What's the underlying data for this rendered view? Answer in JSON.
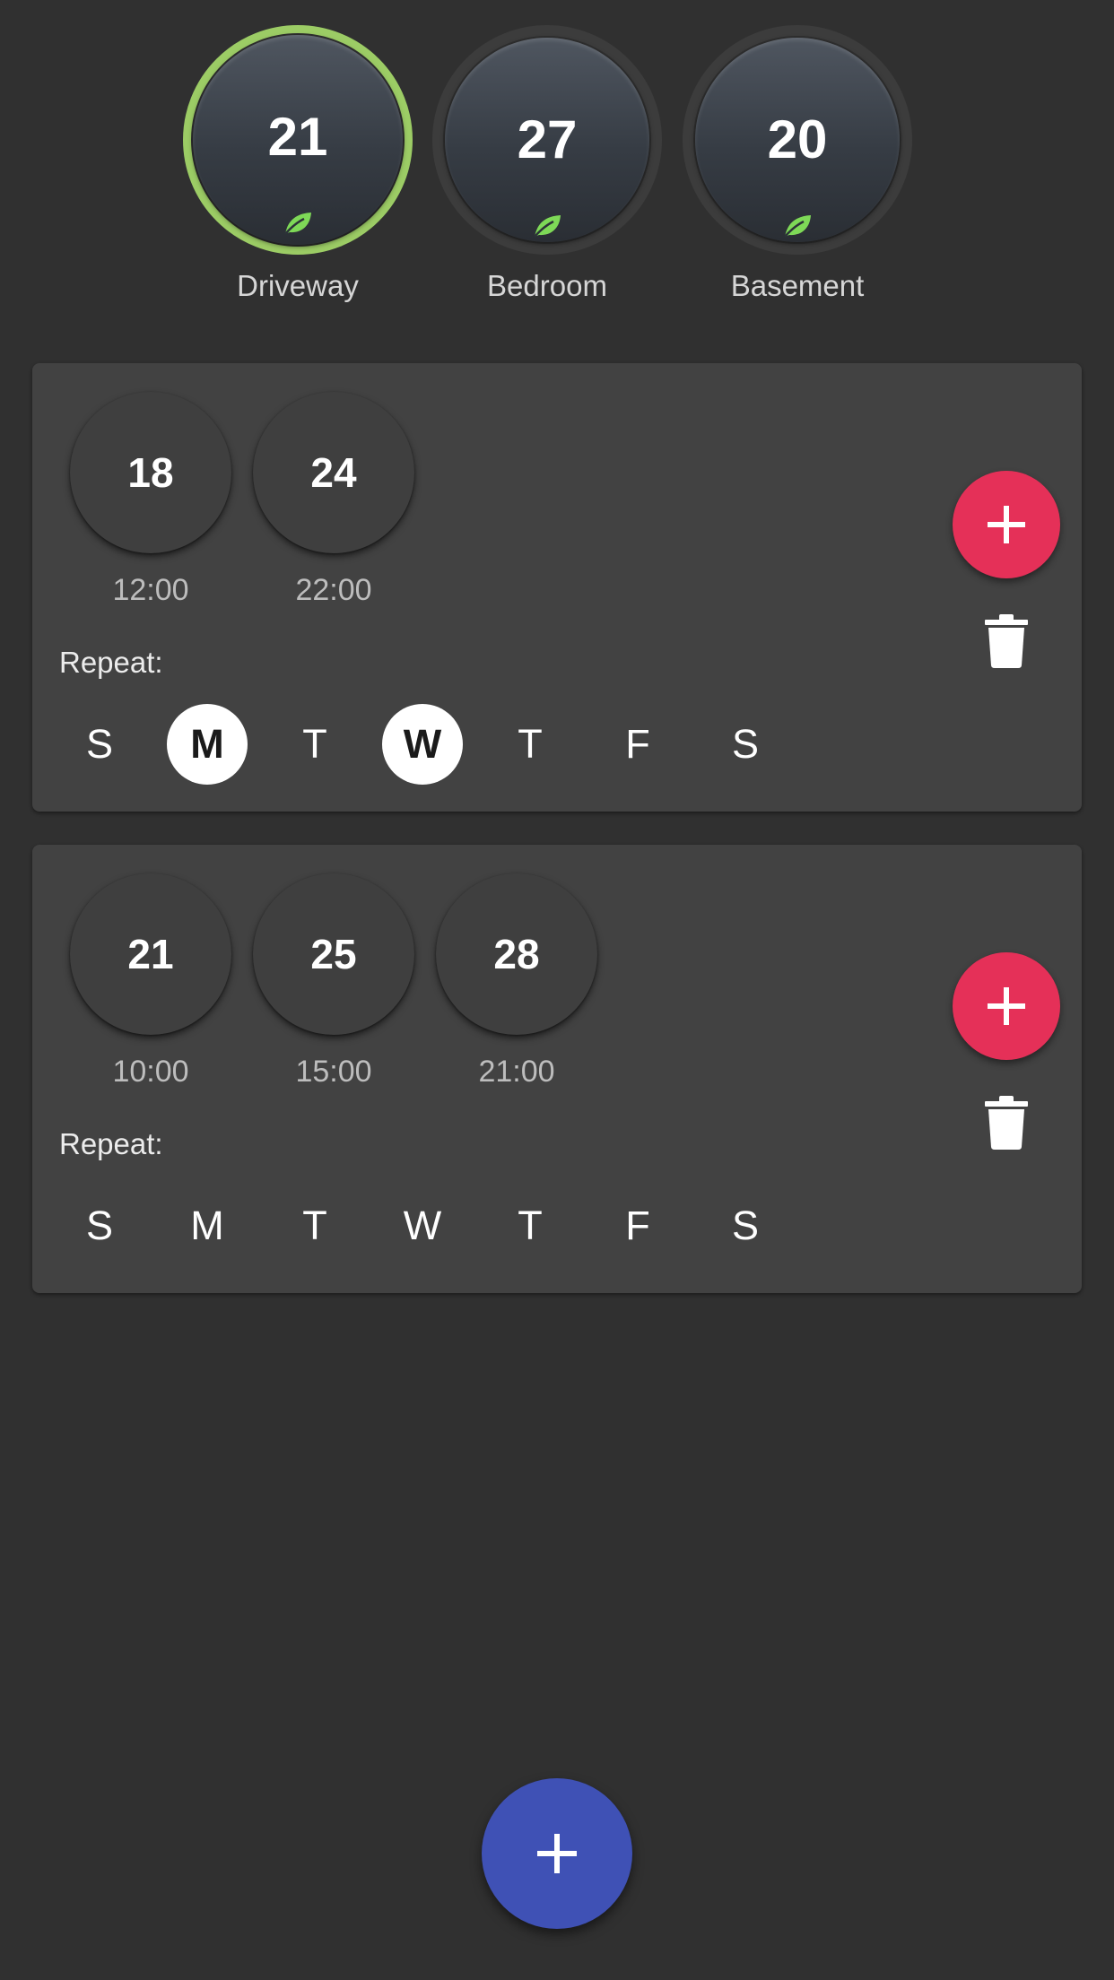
{
  "zones": [
    {
      "name": "Driveway",
      "temperature": "21",
      "selected": true,
      "eco_icon": "leaf-icon",
      "ring_color": "#9ccc65"
    },
    {
      "name": "Bedroom",
      "temperature": "27",
      "selected": false,
      "eco_icon": "leaf-icon"
    },
    {
      "name": "Basement",
      "temperature": "20",
      "selected": false,
      "eco_icon": "leaf-icon"
    }
  ],
  "schedules": [
    {
      "setpoints": [
        {
          "temperature": "18",
          "time": "12:00"
        },
        {
          "temperature": "24",
          "time": "22:00"
        }
      ],
      "repeat_label": "Repeat:",
      "days": [
        {
          "letter": "S",
          "selected": false
        },
        {
          "letter": "M",
          "selected": true
        },
        {
          "letter": "T",
          "selected": false
        },
        {
          "letter": "W",
          "selected": true
        },
        {
          "letter": "T",
          "selected": false
        },
        {
          "letter": "F",
          "selected": false
        },
        {
          "letter": "S",
          "selected": false
        }
      ],
      "add_icon": "plus-icon",
      "delete_icon": "trash-icon"
    },
    {
      "setpoints": [
        {
          "temperature": "21",
          "time": "10:00"
        },
        {
          "temperature": "25",
          "time": "15:00"
        },
        {
          "temperature": "28",
          "time": "21:00"
        }
      ],
      "repeat_label": "Repeat:",
      "days": [
        {
          "letter": "S",
          "selected": false
        },
        {
          "letter": "M",
          "selected": false
        },
        {
          "letter": "T",
          "selected": false
        },
        {
          "letter": "W",
          "selected": false
        },
        {
          "letter": "T",
          "selected": false
        },
        {
          "letter": "F",
          "selected": false
        },
        {
          "letter": "S",
          "selected": false
        }
      ],
      "add_icon": "plus-icon",
      "delete_icon": "trash-icon"
    }
  ],
  "main_fab_icon": "plus-icon",
  "colors": {
    "background": "#303030",
    "card": "#424242",
    "active_ring": "#9ccc65",
    "leaf": "#7ed957",
    "add_button": "#e53058",
    "main_fab": "#3f51b5",
    "selected_day": "#ffffff"
  }
}
